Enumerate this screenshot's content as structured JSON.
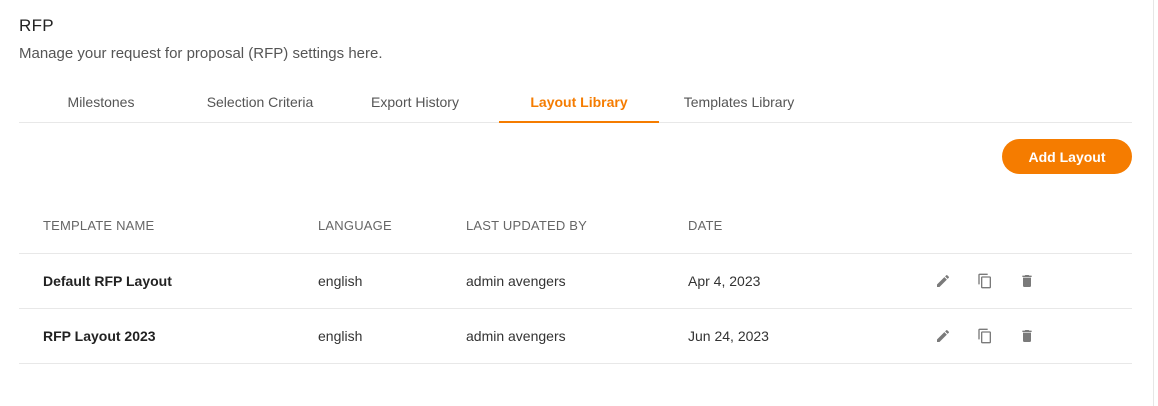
{
  "header": {
    "title": "RFP",
    "subtitle": "Manage your request for proposal (RFP) settings here."
  },
  "tabs": [
    {
      "label": "Milestones",
      "active": false
    },
    {
      "label": "Selection Criteria",
      "active": false
    },
    {
      "label": "Export History",
      "active": false
    },
    {
      "label": "Layout Library",
      "active": true
    },
    {
      "label": "Templates Library",
      "active": false
    }
  ],
  "toolbar": {
    "add_label": "Add Layout"
  },
  "table": {
    "columns": [
      "TEMPLATE NAME",
      "LANGUAGE",
      "LAST UPDATED BY",
      "DATE"
    ],
    "rows": [
      {
        "name": "Default RFP Layout",
        "language": "english",
        "updated_by": "admin avengers",
        "date": "Apr 4, 2023"
      },
      {
        "name": "RFP Layout 2023",
        "language": "english",
        "updated_by": "admin avengers",
        "date": "Jun 24, 2023"
      }
    ],
    "row_actions": [
      "edit-icon",
      "copy-icon",
      "delete-icon"
    ]
  },
  "colors": {
    "accent": "#f57c00",
    "icon": "#7a7a7a",
    "divider": "#e8e8e8"
  }
}
